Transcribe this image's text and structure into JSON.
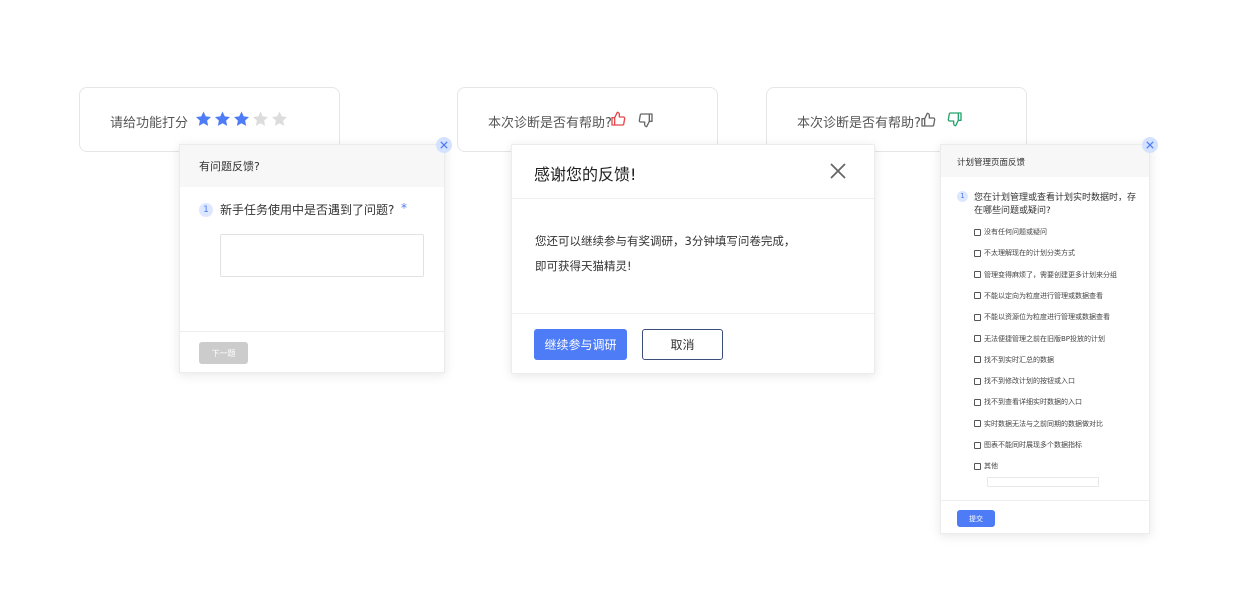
{
  "rating_card": {
    "label": "请给功能打分",
    "stars": {
      "filled": 3,
      "total": 5
    }
  },
  "thumbs_up_card": {
    "label": "本次诊断是否有帮助?",
    "selected": "thumbs-up",
    "active_color": "#e5484d"
  },
  "thumbs_down_card": {
    "label": "本次诊断是否有帮助?",
    "selected": "thumbs-down",
    "active_color": "#23a36b"
  },
  "problem_panel": {
    "title": "有问题反馈?",
    "question_number": "1",
    "question": "新手任务使用中是否遇到了问题?",
    "required_mark": "*",
    "answer_value": "",
    "next_label": "下一题"
  },
  "thanks_dialog": {
    "title": "感谢您的反馈!",
    "line1": "您还可以继续参与有奖调研，3分钟填写问卷完成，",
    "line2": "即可获得天猫精灵!",
    "primary_label": "继续参与调研",
    "cancel_label": "取消"
  },
  "plan_panel": {
    "title": "计划管理页面反馈",
    "question_number": "1",
    "question_line1": "您在计划管理或查看计划实时数据时，存",
    "question_line2": "在哪些问题或疑问?",
    "options": [
      "没有任何问题或疑问",
      "不太理解现在的计划分类方式",
      "管理变得麻烦了，需要创建更多计划来分组",
      "不能以定向为粒度进行管理或数据查看",
      "不能以资源位为粒度进行管理或数据查看",
      "无法便捷管理之前在旧版BP投放的计划",
      "找不到实时汇总的数据",
      "找不到修改计划的按钮或入口",
      "找不到查看详细实时数据的入口",
      "实时数据无法与之前同期的数据做对比",
      "图表不能同时展现多个数据指标",
      "其他"
    ],
    "other_value": "",
    "submit_label": "提交"
  },
  "colors": {
    "accent": "#4e7cf6",
    "star_filled": "#4e7cf6",
    "star_empty": "#dcdcdc",
    "disabled_button": "#cccccc"
  }
}
